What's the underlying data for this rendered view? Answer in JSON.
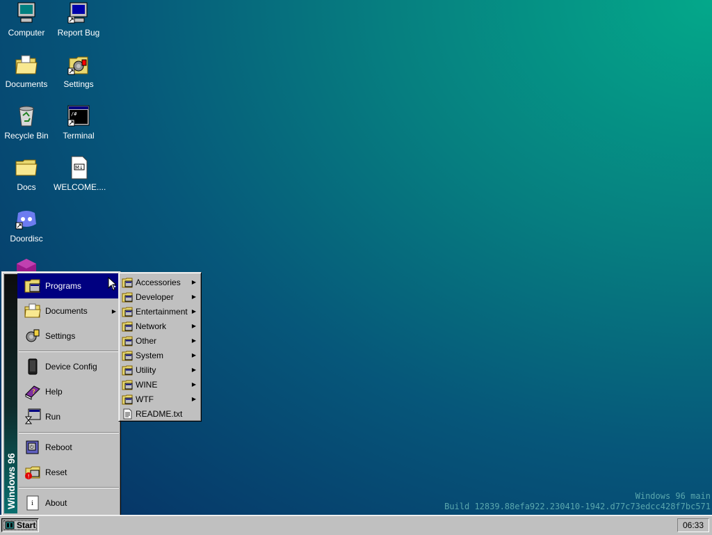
{
  "desktop": {
    "icons": [
      {
        "label": "Computer",
        "icon": "computer-icon"
      },
      {
        "label": "Report Bug",
        "icon": "report-bug-icon"
      },
      {
        "label": "Documents",
        "icon": "documents-folder-icon"
      },
      {
        "label": "Settings",
        "icon": "settings-icon"
      },
      {
        "label": "Recycle Bin",
        "icon": "recycle-bin-icon"
      },
      {
        "label": "Terminal",
        "icon": "terminal-icon"
      },
      {
        "label": "Docs",
        "icon": "folder-icon"
      },
      {
        "label": "WELCOME....",
        "icon": "markdown-file-icon"
      },
      {
        "label": "Doordisc",
        "icon": "doordisc-icon"
      }
    ]
  },
  "start_menu": {
    "banner": "Windows 96",
    "items": [
      {
        "label": "Programs",
        "icon": "programs-icon",
        "has_submenu": true,
        "active": true
      },
      {
        "label": "Documents",
        "icon": "documents-icon",
        "has_submenu": true
      },
      {
        "label": "Settings",
        "icon": "settings-icon"
      },
      {
        "label": "Device Config",
        "icon": "device-config-icon"
      },
      {
        "label": "Help",
        "icon": "help-book-icon"
      },
      {
        "label": "Run",
        "icon": "run-icon"
      },
      {
        "label": "Reboot",
        "icon": "reboot-icon"
      },
      {
        "label": "Reset",
        "icon": "reset-icon"
      },
      {
        "label": "About",
        "icon": "about-icon"
      }
    ]
  },
  "programs_submenu": {
    "items": [
      {
        "label": "Accessories",
        "has_submenu": true
      },
      {
        "label": "Developer",
        "has_submenu": true
      },
      {
        "label": "Entertainment",
        "has_submenu": true
      },
      {
        "label": "Network",
        "has_submenu": true
      },
      {
        "label": "Other",
        "has_submenu": true
      },
      {
        "label": "System",
        "has_submenu": true
      },
      {
        "label": "Utility",
        "has_submenu": true
      },
      {
        "label": "WINE",
        "has_submenu": true
      },
      {
        "label": "WTF",
        "has_submenu": true
      },
      {
        "label": "README.txt",
        "has_submenu": false
      }
    ]
  },
  "build_info": {
    "line1": "Windows 96 main",
    "line2": "Build 12839.88efa922.230410-1942.d77c73edcc428f7bc571"
  },
  "taskbar": {
    "start_label": "Start",
    "clock": "06:33"
  }
}
